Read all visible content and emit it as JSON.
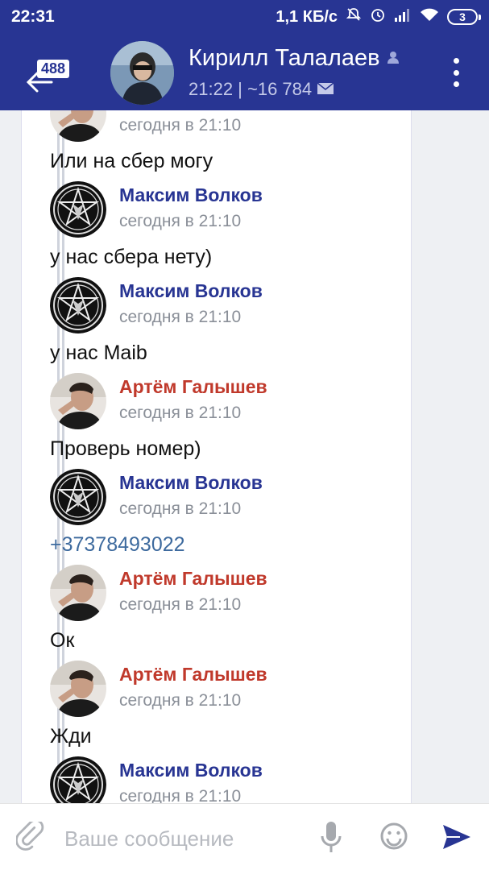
{
  "status_bar": {
    "time": "22:31",
    "speed": "1,1 КБ/с",
    "battery": "3"
  },
  "header": {
    "unread_count": "488",
    "contact_name": "Кирилл Талалаев",
    "subtitle": "21:22 | ~16 784"
  },
  "messages": [
    {
      "author": "",
      "time": "сегодня в 21:10",
      "text": "Или на сбер могу",
      "avatar": "boy-avatar",
      "color": "#c0392b"
    },
    {
      "author": "Максим Волков",
      "time": "сегодня в 21:10",
      "text": "у нас сбера нету)",
      "avatar": "pentagram-avatar",
      "color": "#283593"
    },
    {
      "author": "Максим Волков",
      "time": "сегодня в 21:10",
      "text": "у нас Maib",
      "avatar": "pentagram-avatar",
      "color": "#283593"
    },
    {
      "author": "Артём Галышев",
      "time": "сегодня в 21:10",
      "text": "Проверь номер)",
      "avatar": "boy-avatar",
      "color": "#c0392b"
    },
    {
      "author": "Максим Волков",
      "time": "сегодня в 21:10",
      "text": "+37378493022",
      "avatar": "pentagram-avatar",
      "color": "#283593"
    },
    {
      "author": "Артём Галышев",
      "time": "сегодня в 21:10",
      "text": "Ок",
      "avatar": "boy-avatar",
      "color": "#c0392b"
    },
    {
      "author": "Артём Галышев",
      "time": "сегодня в 21:10",
      "text": "Жди",
      "avatar": "boy-avatar",
      "color": "#c0392b"
    },
    {
      "author": "Максим Волков",
      "time": "сегодня в 21:10",
      "text": "",
      "avatar": "pentagram-avatar",
      "color": "#283593"
    }
  ],
  "input": {
    "placeholder": "Ваше сообщение"
  },
  "colors": {
    "header_bg": "#283593",
    "author_blue": "#283593",
    "author_red": "#c0392b",
    "link": "#3d6a9e"
  }
}
